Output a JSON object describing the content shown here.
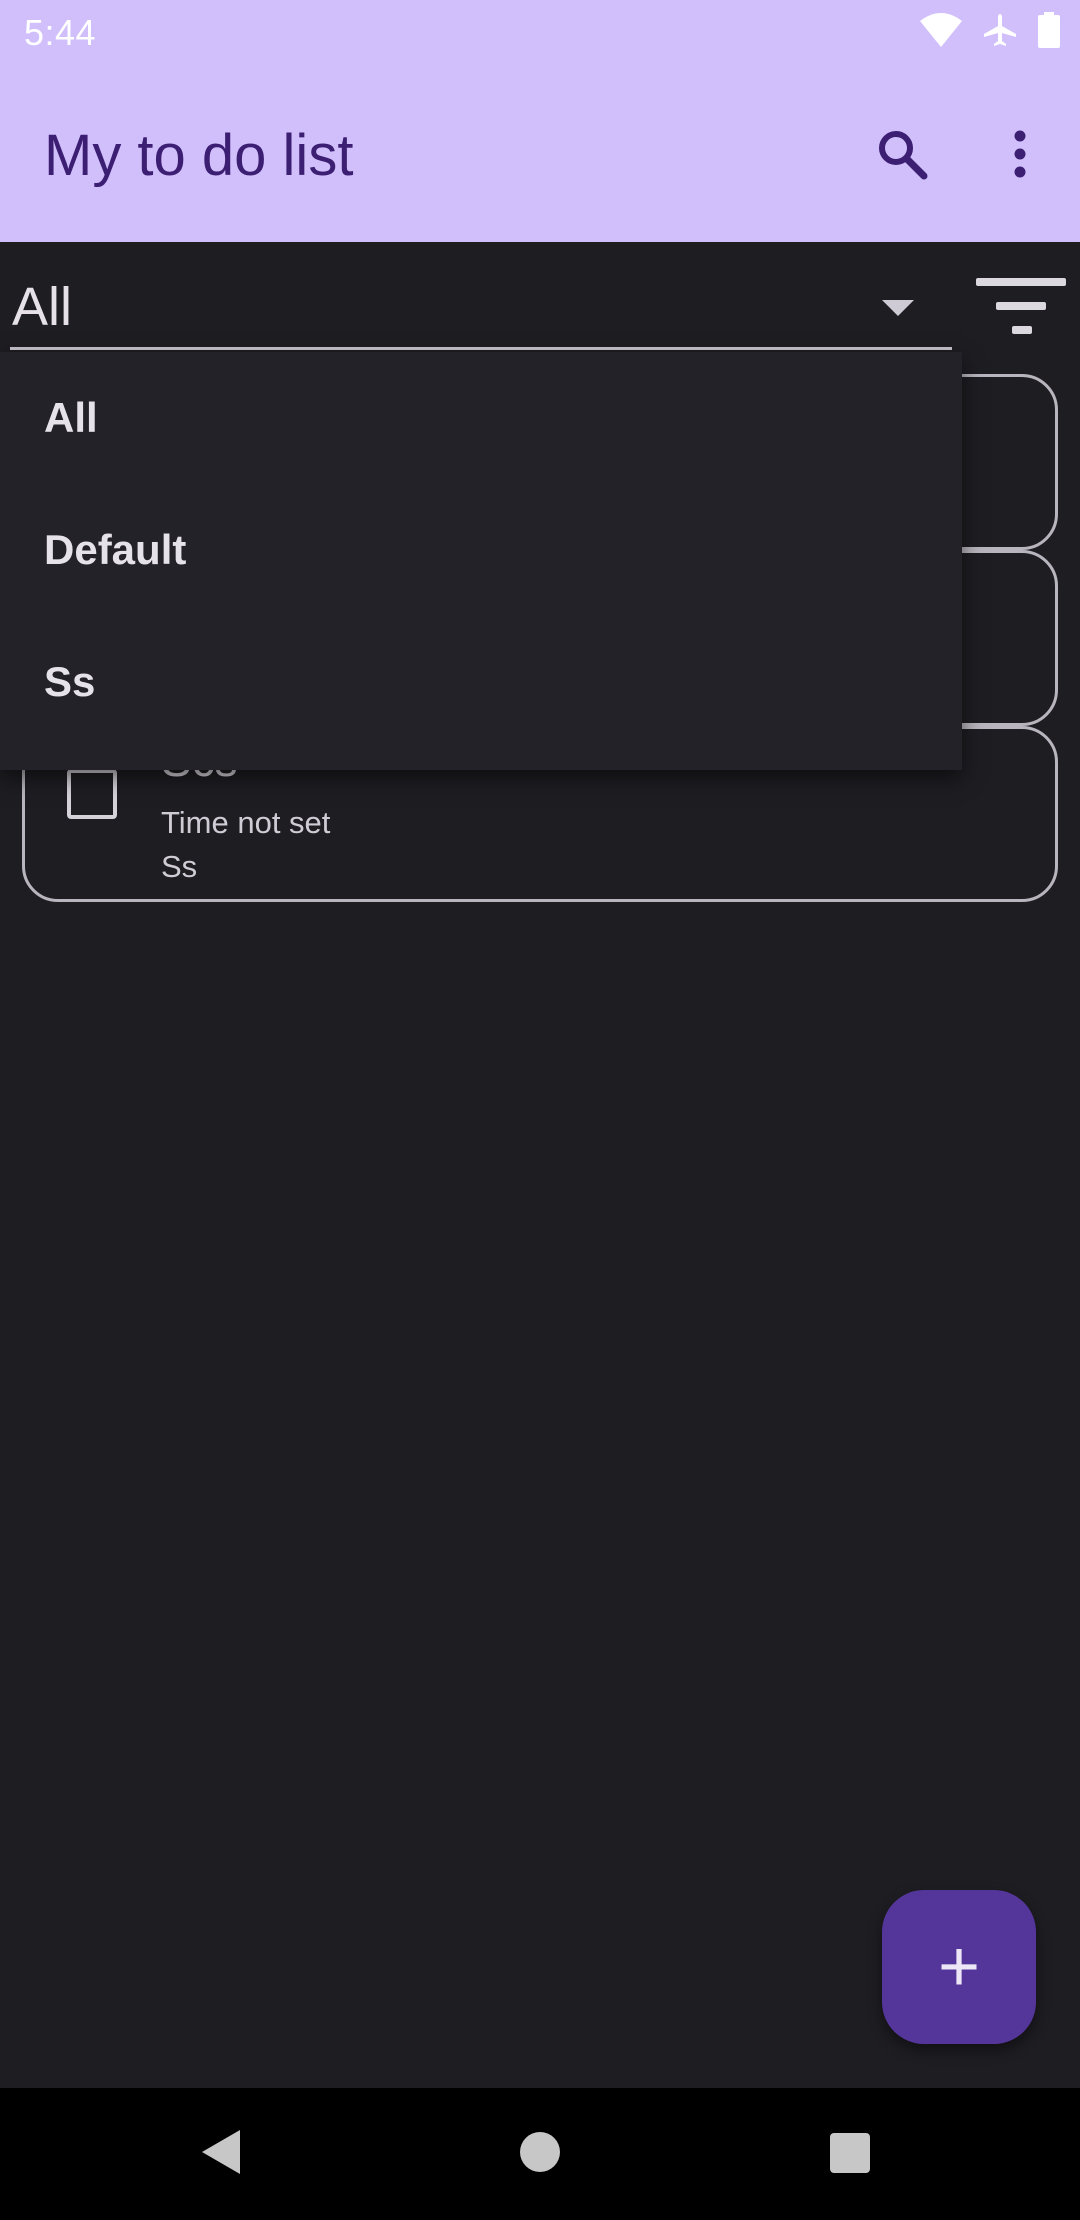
{
  "status_bar": {
    "time": "5:44",
    "icons": [
      "wifi-icon",
      "airplane-icon",
      "battery-icon"
    ]
  },
  "app_bar": {
    "title": "My to do list",
    "actions": [
      "search-icon",
      "more-vert-icon"
    ]
  },
  "filter": {
    "selected": "All",
    "options": [
      "All",
      "Default",
      "Ss"
    ]
  },
  "tasks": [
    {
      "title": "",
      "time": "",
      "category": ""
    },
    {
      "title": "",
      "time": "",
      "category": ""
    },
    {
      "title": "Scs",
      "time": "Time not set",
      "category": "Ss"
    }
  ],
  "fab": {
    "label": "+"
  },
  "colors": {
    "primary_container": "#d1bffc",
    "on_primary_container": "#3c1f72",
    "background": "#1e1d22",
    "fab": "#54369a"
  }
}
